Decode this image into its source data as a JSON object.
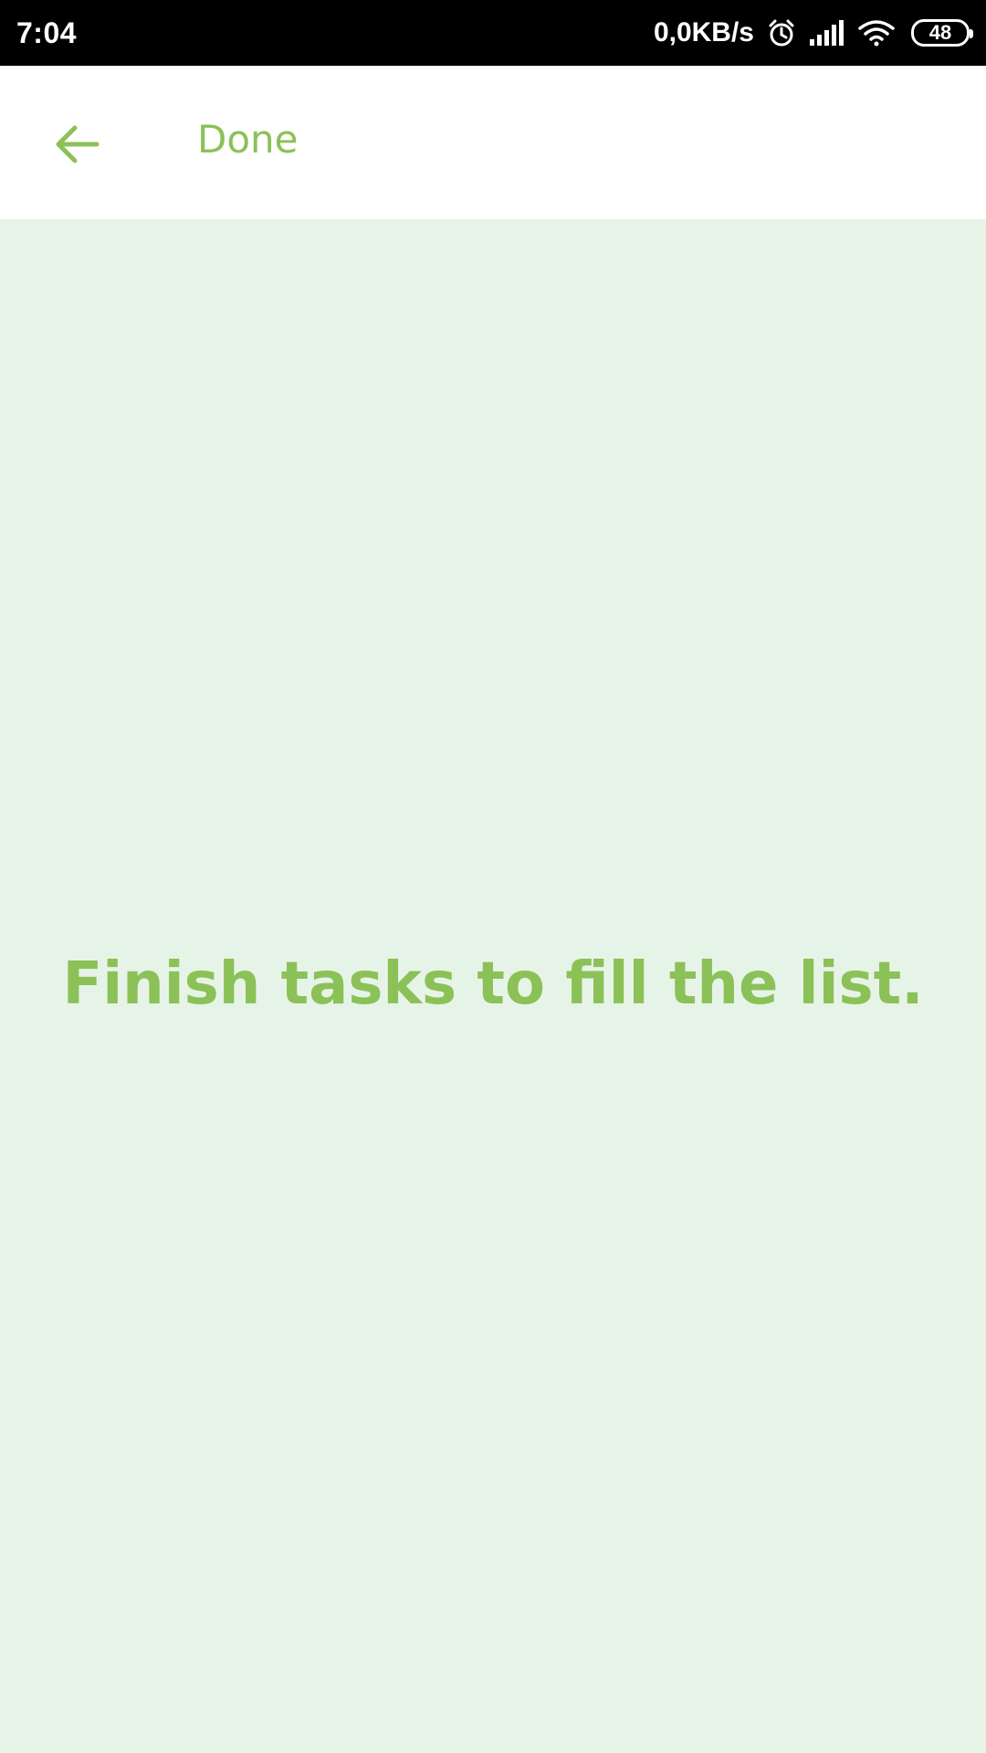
{
  "status_bar": {
    "time": "7:04",
    "network_speed": "0,0KB/s",
    "battery_level": "48",
    "icons": [
      "alarm-icon",
      "signal-icon",
      "wifi-icon",
      "battery-icon"
    ]
  },
  "app_bar": {
    "back_icon": "arrow-left-icon",
    "title": "Done"
  },
  "main": {
    "empty_message": "Finish tasks to fill the list."
  },
  "colors": {
    "accent": "#8BC157",
    "background": "#E6F4E8",
    "app_bar_background": "#FFFFFF",
    "status_bar_background": "#000000"
  }
}
